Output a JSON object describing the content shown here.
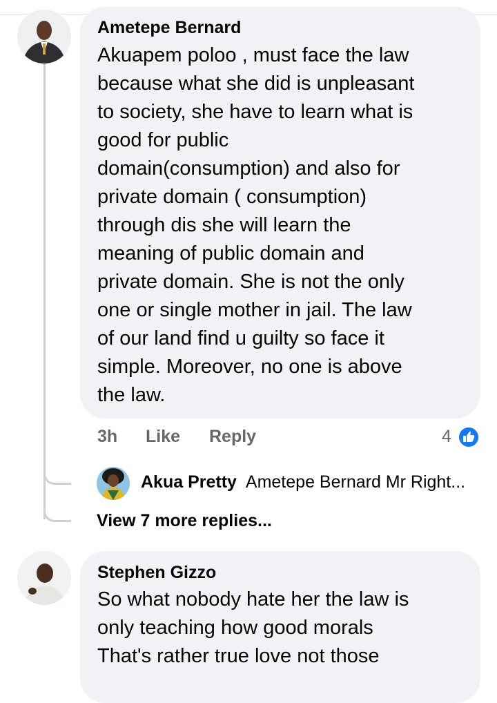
{
  "comment1": {
    "author": "Ametepe Bernard",
    "text_lines": [
      "Akuapem  poloo , must face the law",
      "because what she did is unpleasant",
      "to society, she have to learn what is",
      "good for public",
      "domain(consumption) and also for",
      "private domain ( consumption)",
      "through dis she will learn the",
      "meaning of public domain and",
      "private domain. She is not the only",
      "one or single mother in jail. The law",
      "of our land find u guilty so face it",
      "simple. Moreover, no one is above",
      "the law."
    ],
    "time": "3h",
    "like_label": "Like",
    "reply_label": "Reply",
    "reaction_count": "4",
    "reaction_icon": "like-thumb-icon"
  },
  "reply_preview": {
    "author": "Akua Pretty",
    "text": "Ametepe Bernard Mr Right..."
  },
  "view_more": "View 7 more replies...",
  "comment2": {
    "author": "Stephen Gizzo",
    "text_lines": [
      "So what nobody hate her the law is",
      "only teaching how good morals",
      "That's rather true love not those"
    ]
  },
  "colors": {
    "bubble": "#f0f2f5",
    "meta_text": "#65676b",
    "like_blue": "#1877f2",
    "thread_line": "#ced0d4"
  }
}
